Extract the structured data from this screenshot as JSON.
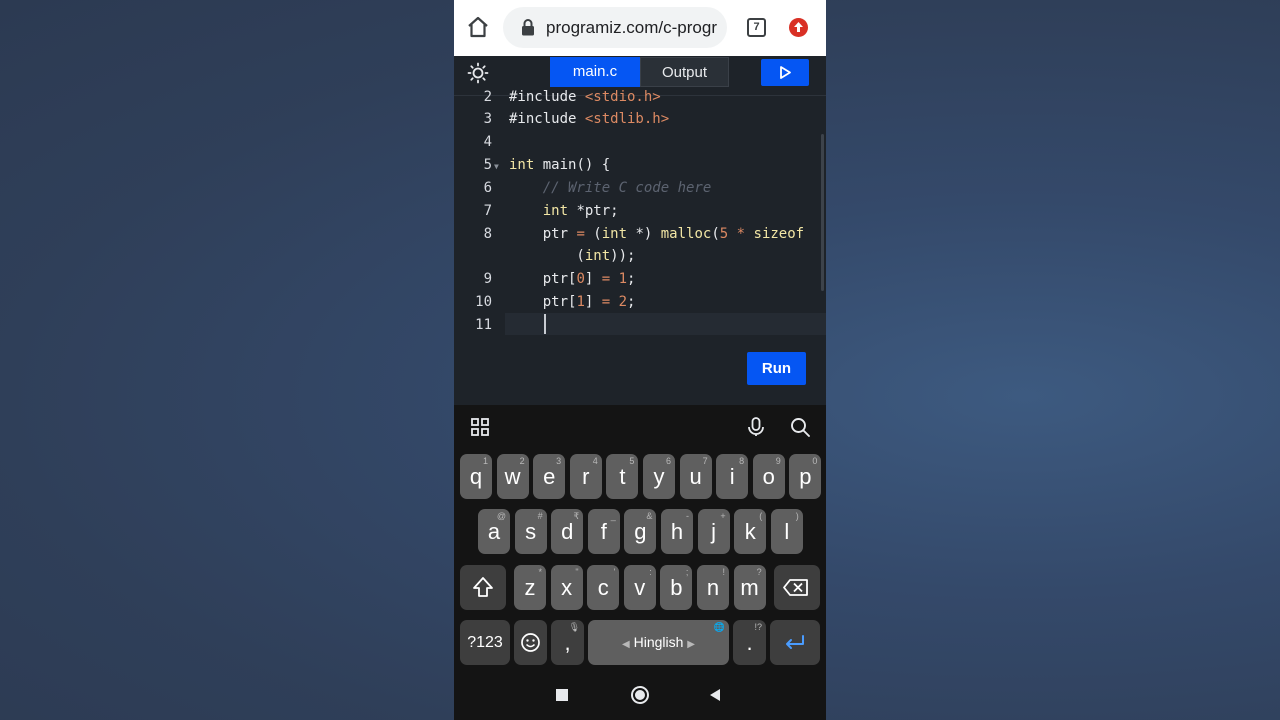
{
  "browser": {
    "url": "programiz.com/c-progr",
    "tab_count": "7"
  },
  "editor": {
    "tabs": [
      "main.c",
      "Output"
    ],
    "run_label": "Run"
  },
  "code": {
    "line_numbers": [
      "2",
      "3",
      "4",
      "5",
      "6",
      "7",
      "8",
      "9",
      "10",
      "11"
    ],
    "lines": [
      "#include <stdio.h>",
      "#include <stdlib.h>",
      "",
      "int main() {",
      "    // Write C code here",
      "    int *ptr;",
      "    ptr = (int *) malloc(5 * sizeof",
      "        (int));",
      "    ptr[0] = 1;",
      "    ptr[1] = 2;",
      ""
    ]
  },
  "keyboard": {
    "row1": [
      {
        "k": "q",
        "h": "1"
      },
      {
        "k": "w",
        "h": "2"
      },
      {
        "k": "e",
        "h": "3"
      },
      {
        "k": "r",
        "h": "4"
      },
      {
        "k": "t",
        "h": "5"
      },
      {
        "k": "y",
        "h": "6"
      },
      {
        "k": "u",
        "h": "7"
      },
      {
        "k": "i",
        "h": "8"
      },
      {
        "k": "o",
        "h": "9"
      },
      {
        "k": "p",
        "h": "0"
      }
    ],
    "row2": [
      {
        "k": "a",
        "h": "@"
      },
      {
        "k": "s",
        "h": "#"
      },
      {
        "k": "d",
        "h": "₹"
      },
      {
        "k": "f",
        "h": "_"
      },
      {
        "k": "g",
        "h": "&"
      },
      {
        "k": "h",
        "h": "-"
      },
      {
        "k": "j",
        "h": "+"
      },
      {
        "k": "k",
        "h": "("
      },
      {
        "k": "l",
        "h": ")"
      }
    ],
    "row3": [
      {
        "k": "z",
        "h": "*"
      },
      {
        "k": "x",
        "h": "\""
      },
      {
        "k": "c",
        "h": "'"
      },
      {
        "k": "v",
        "h": ":"
      },
      {
        "k": "b",
        "h": ";"
      },
      {
        "k": "n",
        "h": "!"
      },
      {
        "k": "m",
        "h": "?"
      }
    ],
    "symbols_label": "?123",
    "comma_label": ",",
    "space_label": "Hinglish",
    "period_label": ".",
    "period_hint": "!?"
  }
}
